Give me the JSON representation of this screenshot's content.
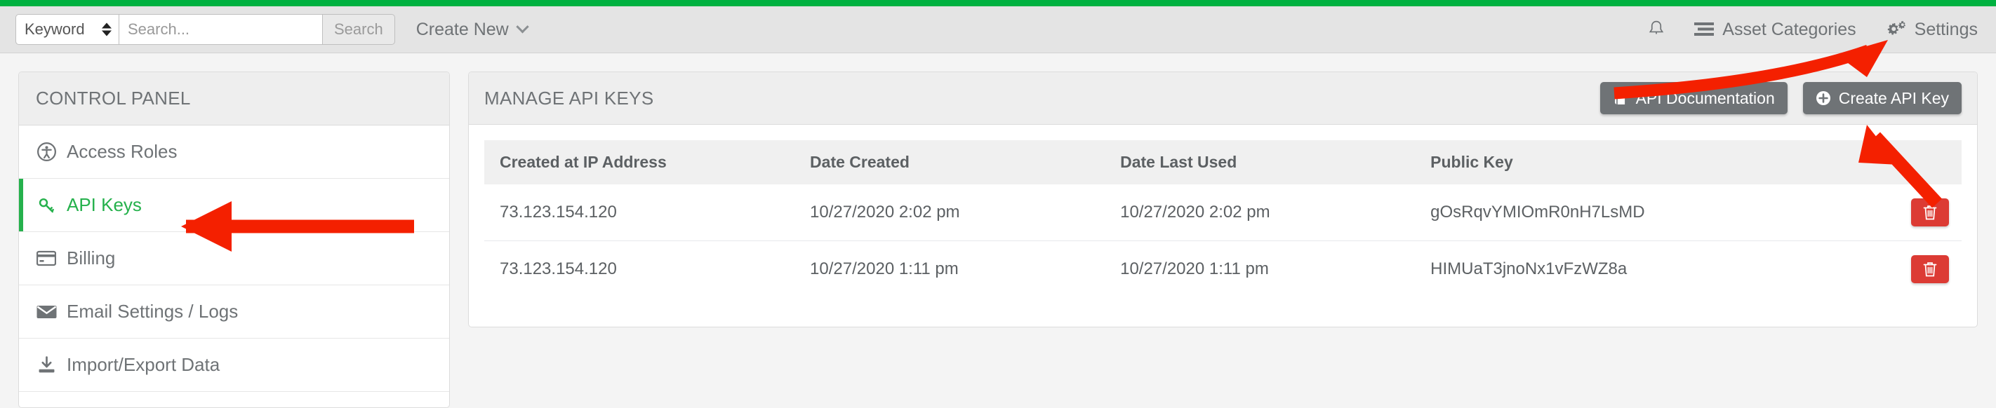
{
  "theme": {
    "accent_green": "#00b140",
    "active_green": "#25b14c",
    "gray_button": "#6f7376",
    "delete_red": "#dc3b34",
    "annotation_red": "#f42000"
  },
  "header": {
    "keyword_select": {
      "value": "Keyword",
      "icon": "updown-arrows-icon"
    },
    "search": {
      "value": "",
      "placeholder": "Search...",
      "button_label": "Search"
    },
    "create_new": {
      "label": "Create New",
      "icon": "chevron-down-icon"
    },
    "notifications": {
      "icon": "bell-icon"
    },
    "asset_categories": {
      "label": "Asset Categories",
      "icon": "list-icon"
    },
    "settings": {
      "label": "Settings",
      "icon": "gears-icon"
    }
  },
  "sidebar": {
    "title": "CONTROL PANEL",
    "items": [
      {
        "label": "Access Roles",
        "icon": "accessibility-icon",
        "active": false
      },
      {
        "label": "API Keys",
        "icon": "key-icon",
        "active": true
      },
      {
        "label": "Billing",
        "icon": "credit-card-icon",
        "active": false
      },
      {
        "label": "Email Settings / Logs",
        "icon": "envelope-icon",
        "active": false
      },
      {
        "label": "Import/Export Data",
        "icon": "download-icon",
        "active": false
      }
    ]
  },
  "main": {
    "title": "MANAGE API KEYS",
    "buttons": [
      {
        "label": "API Documentation",
        "icon": "book-icon"
      },
      {
        "label": "Create API Key",
        "icon": "plus-circle-icon"
      }
    ],
    "table": {
      "columns": [
        "Created at IP Address",
        "Date Created",
        "Date Last Used",
        "Public Key",
        ""
      ],
      "rows": [
        {
          "ip": "73.123.154.120",
          "date_created": "10/27/2020 2:02 pm",
          "date_last_used": "10/27/2020 2:02 pm",
          "public_key": "gOsRqvYMIOmR0nH7LsMD",
          "action_icon": "trash-icon"
        },
        {
          "ip": "73.123.154.120",
          "date_created": "10/27/2020 1:11 pm",
          "date_last_used": "10/27/2020 1:11 pm",
          "public_key": "HIMUaT3jnoNx1vFzWZ8a",
          "action_icon": "trash-icon"
        }
      ]
    }
  },
  "annotations": [
    {
      "name": "arrow-to-api-keys",
      "points_to": "API Keys"
    },
    {
      "name": "arrow-to-settings",
      "points_to": "Settings"
    },
    {
      "name": "arrow-to-create-api-key",
      "points_to": "Create API Key"
    }
  ]
}
